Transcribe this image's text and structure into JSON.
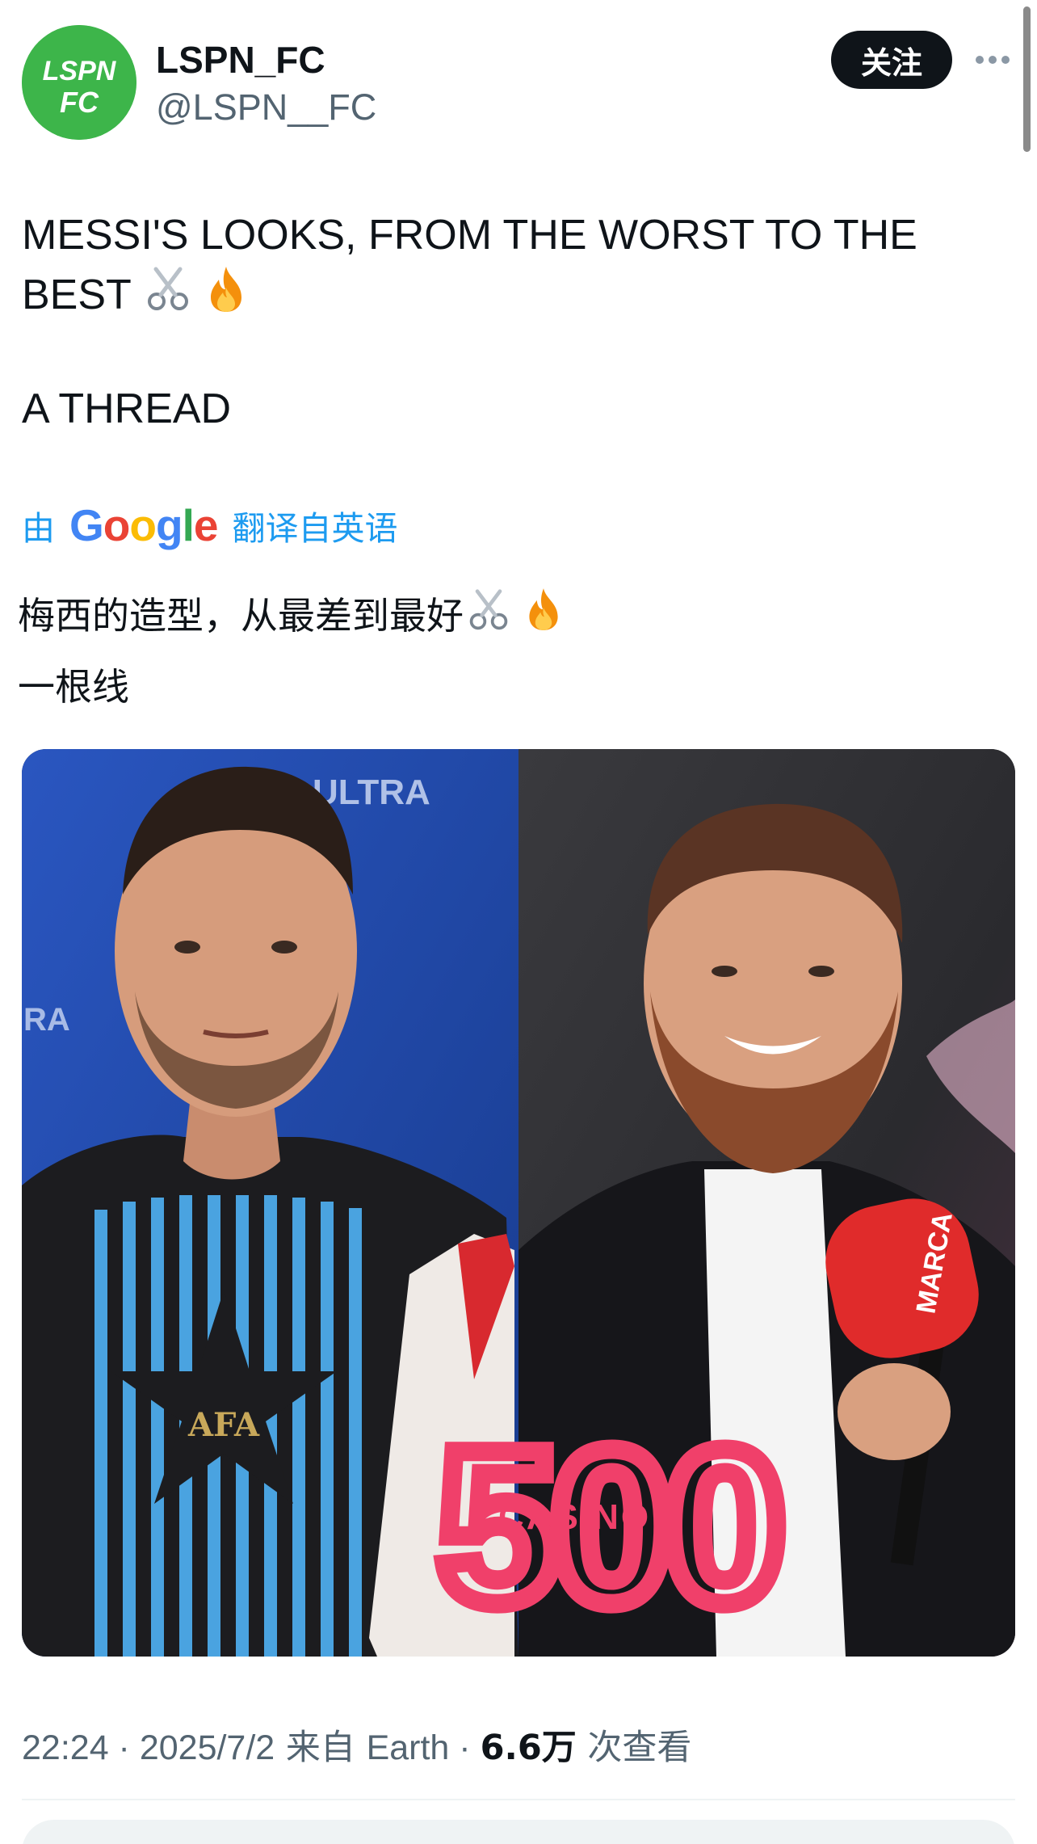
{
  "author": {
    "display_name": "LSPN_FC",
    "handle": "@LSPN__FC",
    "avatar_text_top": "LSPN",
    "avatar_text_bottom": "FC",
    "avatar_color": "#3db54a"
  },
  "actions": {
    "follow_label": "关注",
    "more_icon": "more-horizontal-icon"
  },
  "tweet": {
    "line1": "MESSI'S LOOKS, FROM THE WORST TO THE",
    "line2": "BEST",
    "line3": "A THREAD",
    "emojis": [
      "scissors-icon",
      "fire-icon"
    ]
  },
  "translation": {
    "prefix": "由",
    "provider": "Google",
    "suffix": "翻译自英语",
    "line1": "梅西的造型，从最差到最好",
    "line2": "一根线"
  },
  "media": {
    "overlay_number": "500",
    "overlay_word": "CASINO",
    "mic_brand": "MARCA",
    "backdrop_left": "ULTRA",
    "backdrop_left2": "RA",
    "shirt_crest": "AFA",
    "overlay_color": "#f0406a"
  },
  "meta": {
    "time": "22:24",
    "sep1": " · ",
    "date": "2025/7/2",
    "source_prefix": " 来自 ",
    "source": "Earth",
    "sep2": " · ",
    "views_count": "6.6万",
    "views_label": " 次查看"
  },
  "colors": {
    "link": "#1d9bf0",
    "secondary_text": "#536471",
    "primary_text": "#0f1419"
  }
}
